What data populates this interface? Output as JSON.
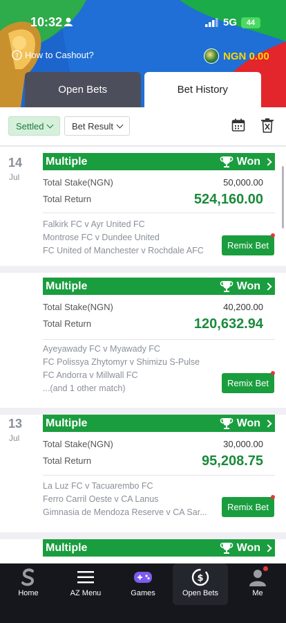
{
  "status": {
    "time": "10:32",
    "network": "5G",
    "battery": "44"
  },
  "header": {
    "cashout_label": "How to Cashout?",
    "balance": "NGN 0.00"
  },
  "tabs": [
    {
      "label": "Open Bets"
    },
    {
      "label": "Bet History"
    }
  ],
  "filters": {
    "settled_label": "Settled",
    "result_label": "Bet Result"
  },
  "common": {
    "stake_label": "Total Stake(NGN)",
    "return_label": "Total Return",
    "remix_label": "Remix Bet",
    "won_label": "Won",
    "type_label": "Multiple"
  },
  "days": [
    {
      "day": "14",
      "month": "Jul"
    },
    {
      "day": "13",
      "month": "Jul"
    }
  ],
  "bets": [
    {
      "type": "Multiple",
      "status": "Won",
      "stake": "50,000.00",
      "return": "524,160.00",
      "matches": [
        "Falkirk FC v Ayr United FC",
        "Montrose FC v Dundee United",
        "FC United of Manchester v Rochdale AFC"
      ]
    },
    {
      "type": "Multiple",
      "status": "Won",
      "stake": "40,200.00",
      "return": "120,632.94",
      "matches": [
        "Ayeyawady FC v Myawady FC",
        "FC Polissya Zhytomyr v Shimizu S-Pulse",
        "FC Andorra v Millwall FC",
        "...(and 1 other match)"
      ]
    },
    {
      "type": "Multiple",
      "status": "Won",
      "stake": "30,000.00",
      "return": "95,208.75",
      "matches": [
        "La Luz FC v Tacuarembo FC",
        "Ferro Carril Oeste v CA Lanus",
        "Gimnasia de Mendoza Reserve v CA Sar..."
      ]
    },
    {
      "type": "Multiple",
      "status": "Won"
    }
  ],
  "nav": [
    {
      "label": "Home",
      "icon": "sporty-logo-icon"
    },
    {
      "label": "AZ Menu",
      "icon": "menu-icon"
    },
    {
      "label": "Games",
      "icon": "gamepad-icon"
    },
    {
      "label": "Open Bets",
      "icon": "open-bets-icon"
    },
    {
      "label": "Me",
      "icon": "user-icon"
    }
  ],
  "colors": {
    "accent_green": "#1a9d3e",
    "header_blue": "#1f6fd6",
    "balance_yellow": "#ffd600"
  }
}
